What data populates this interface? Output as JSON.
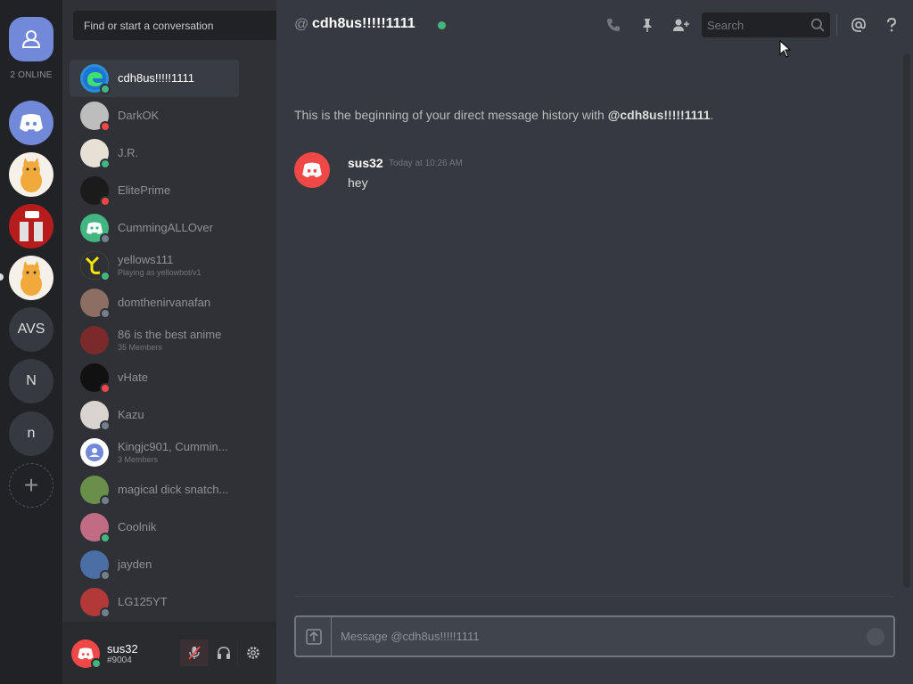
{
  "guilds": {
    "online_count": "2 ONLINE",
    "items": [
      {
        "name": "discord-server"
      },
      {
        "name": "cat-server-1"
      },
      {
        "name": "youtube-server"
      },
      {
        "name": "cat-server-2"
      },
      {
        "label": "AVS"
      },
      {
        "label": "N"
      },
      {
        "label": "n"
      }
    ],
    "add_label": "+"
  },
  "dm_search": {
    "placeholder": "Find or start a conversation"
  },
  "dms": [
    {
      "name": "cdh8us!!!!!1111",
      "status": "online",
      "active": true,
      "color": "#2b8fd6"
    },
    {
      "name": "DarkOK",
      "status": "dnd",
      "color": "#bdbdbd"
    },
    {
      "name": "J.R.",
      "status": "online",
      "color": "#e7e0d5"
    },
    {
      "name": "ElitePrime",
      "status": "dnd",
      "color": "#1b1b1b"
    },
    {
      "name": "CummingALLOver",
      "status": "offline",
      "color": "#43b581"
    },
    {
      "name": "yellows111",
      "sub": "Playing as yellowbot/v1",
      "status": "online",
      "color": "#f7e600"
    },
    {
      "name": "domthenirvanafan",
      "status": "offline",
      "color": "#8d6e63"
    },
    {
      "name": "86 is the best anime",
      "sub": "35 Members",
      "status": "",
      "color": "#7b2a2a"
    },
    {
      "name": "vHate",
      "status": "dnd",
      "color": "#111111"
    },
    {
      "name": "Kazu",
      "status": "offline",
      "color": "#d9d4cf"
    },
    {
      "name": "Kingjc901, Cummin...",
      "sub": "3 Members",
      "status": "",
      "color": "#ffffff"
    },
    {
      "name": "magical dick snatch...",
      "status": "offline",
      "color": "#6a8f4a"
    },
    {
      "name": "Coolnik",
      "status": "online",
      "color": "#c06c84"
    },
    {
      "name": "jayden",
      "status": "offline",
      "color": "#4a6fa5"
    },
    {
      "name": "LG125YT",
      "status": "offline",
      "color": "#b33939"
    }
  ],
  "user_panel": {
    "username": "sus32",
    "tag": "#9004",
    "mic_muted": true
  },
  "header": {
    "at": "@",
    "title": "cdh8us!!!!!1111",
    "status_color": "#43b581",
    "search_placeholder": "Search"
  },
  "intro": {
    "prefix": "This is the beginning of your direct message history with ",
    "mention": "@cdh8us!!!!!1111",
    "suffix": "."
  },
  "messages": [
    {
      "author": "sus32",
      "timestamp": "Today at 10:26 AM",
      "text": "hey"
    }
  ],
  "composer": {
    "placeholder": "Message @cdh8us!!!!!1111"
  },
  "colors": {
    "accent": "#7289da",
    "online": "#43b581",
    "dnd": "#f04747",
    "offline": "#747f8d"
  }
}
